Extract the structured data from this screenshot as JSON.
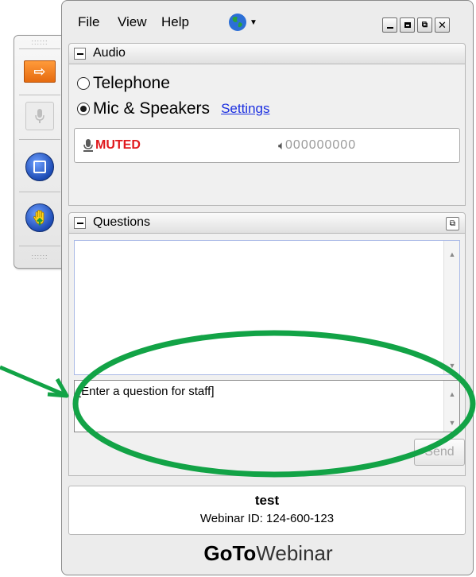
{
  "menu": {
    "file": "File",
    "view": "View",
    "help": "Help",
    "globe_icon": "globe-icon"
  },
  "window_controls": [
    "minimize",
    "maximize",
    "restore",
    "close"
  ],
  "side_toolbar": {
    "icons": [
      "show-panel-arrow-icon",
      "microphone-icon",
      "screen-share-icon",
      "raise-hand-icon"
    ]
  },
  "audio": {
    "title": "Audio",
    "telephone_label": "Telephone",
    "mic_label": "Mic & Speakers",
    "settings_link": "Settings",
    "selected": "Mic & Speakers",
    "muted_label": "MUTED",
    "level_readout": "000000000"
  },
  "questions": {
    "title": "Questions",
    "question_log": "",
    "input_placeholder": "[Enter a question for staff]",
    "send_label": "Send"
  },
  "info": {
    "webinar_title": "test",
    "webinar_id": "Webinar ID: 124-600-123"
  },
  "brand": {
    "bold": "GoTo",
    "regular": "Webinar"
  },
  "colors": {
    "muted": "#e0191d",
    "link": "#1a2ee0",
    "annotation": "#12a346",
    "accent_orange": "#f07b1c",
    "button_blue": "#1d4bb4"
  }
}
